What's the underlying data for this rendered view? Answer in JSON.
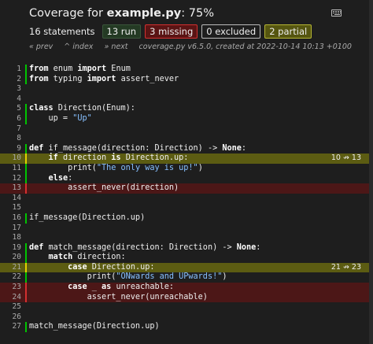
{
  "header": {
    "title_prefix": "Coverage for ",
    "filename": "example.py",
    "title_suffix": ": 75%"
  },
  "stats": {
    "statements": "16 statements",
    "run": "13 run",
    "missing": "3 missing",
    "excluded": "0 excluded",
    "partial": "2 partial"
  },
  "nav": {
    "prev": "« prev",
    "index": "^ index",
    "next": "» next",
    "info": "coverage.py v6.5.0, created at 2022-10-14 10:13 +0100"
  },
  "lines": [
    {
      "n": "1",
      "status": "run",
      "tokens": [
        [
          "k",
          "from"
        ],
        [
          "t",
          " enum "
        ],
        [
          "k",
          "import"
        ],
        [
          "t",
          " Enum"
        ]
      ]
    },
    {
      "n": "2",
      "status": "run",
      "tokens": [
        [
          "k",
          "from"
        ],
        [
          "t",
          " typing "
        ],
        [
          "k",
          "import"
        ],
        [
          "t",
          " assert_never"
        ]
      ]
    },
    {
      "n": "3",
      "status": "",
      "tokens": []
    },
    {
      "n": "4",
      "status": "",
      "tokens": []
    },
    {
      "n": "5",
      "status": "run",
      "tokens": [
        [
          "k",
          "class"
        ],
        [
          "t",
          " Direction(Enum):"
        ]
      ]
    },
    {
      "n": "6",
      "status": "run",
      "tokens": [
        [
          "t",
          "    up = "
        ],
        [
          "s",
          "\"Up\""
        ]
      ]
    },
    {
      "n": "7",
      "status": "",
      "tokens": []
    },
    {
      "n": "8",
      "status": "",
      "tokens": []
    },
    {
      "n": "9",
      "status": "run",
      "tokens": [
        [
          "k",
          "def"
        ],
        [
          "t",
          " if_message(direction: Direction) -> "
        ],
        [
          "k",
          "None"
        ],
        [
          "t",
          ":"
        ]
      ]
    },
    {
      "n": "10",
      "status": "par",
      "annotation": "10 ↛ 13",
      "tokens": [
        [
          "t",
          "    "
        ],
        [
          "k",
          "if"
        ],
        [
          "t",
          " direction "
        ],
        [
          "k",
          "is"
        ],
        [
          "t",
          " Direction.up:"
        ]
      ]
    },
    {
      "n": "11",
      "status": "run",
      "tokens": [
        [
          "t",
          "        print("
        ],
        [
          "s",
          "\"The only way is up!\""
        ],
        [
          "t",
          ")"
        ]
      ]
    },
    {
      "n": "12",
      "status": "run",
      "tokens": [
        [
          "t",
          "    "
        ],
        [
          "k",
          "else"
        ],
        [
          "t",
          ":"
        ]
      ]
    },
    {
      "n": "13",
      "status": "mis",
      "tokens": [
        [
          "t",
          "        assert_never(direction)"
        ]
      ]
    },
    {
      "n": "14",
      "status": "",
      "tokens": []
    },
    {
      "n": "15",
      "status": "",
      "tokens": []
    },
    {
      "n": "16",
      "status": "run",
      "tokens": [
        [
          "t",
          "if_message(Direction.up)"
        ]
      ]
    },
    {
      "n": "17",
      "status": "",
      "tokens": []
    },
    {
      "n": "18",
      "status": "",
      "tokens": []
    },
    {
      "n": "19",
      "status": "run",
      "tokens": [
        [
          "k",
          "def"
        ],
        [
          "t",
          " match_message(direction: Direction) -> "
        ],
        [
          "k",
          "None"
        ],
        [
          "t",
          ":"
        ]
      ]
    },
    {
      "n": "20",
      "status": "run",
      "tokens": [
        [
          "t",
          "    "
        ],
        [
          "k",
          "match"
        ],
        [
          "t",
          " direction:"
        ]
      ]
    },
    {
      "n": "21",
      "status": "par",
      "annotation": "21 ↛ 23",
      "tokens": [
        [
          "t",
          "        "
        ],
        [
          "k",
          "case"
        ],
        [
          "t",
          " Direction.up:"
        ]
      ]
    },
    {
      "n": "22",
      "status": "run",
      "tokens": [
        [
          "t",
          "            print("
        ],
        [
          "s",
          "\"ONwards and UPwards!\""
        ],
        [
          "t",
          ")"
        ]
      ]
    },
    {
      "n": "23",
      "status": "mis",
      "tokens": [
        [
          "t",
          "        "
        ],
        [
          "k",
          "case"
        ],
        [
          "t",
          " _ "
        ],
        [
          "k",
          "as"
        ],
        [
          "t",
          " unreachable:"
        ]
      ]
    },
    {
      "n": "24",
      "status": "mis",
      "tokens": [
        [
          "t",
          "            assert_never(unreachable)"
        ]
      ]
    },
    {
      "n": "25",
      "status": "",
      "tokens": []
    },
    {
      "n": "26",
      "status": "",
      "tokens": []
    },
    {
      "n": "27",
      "status": "run",
      "tokens": [
        [
          "t",
          "match_message(Direction.up)"
        ]
      ]
    }
  ]
}
